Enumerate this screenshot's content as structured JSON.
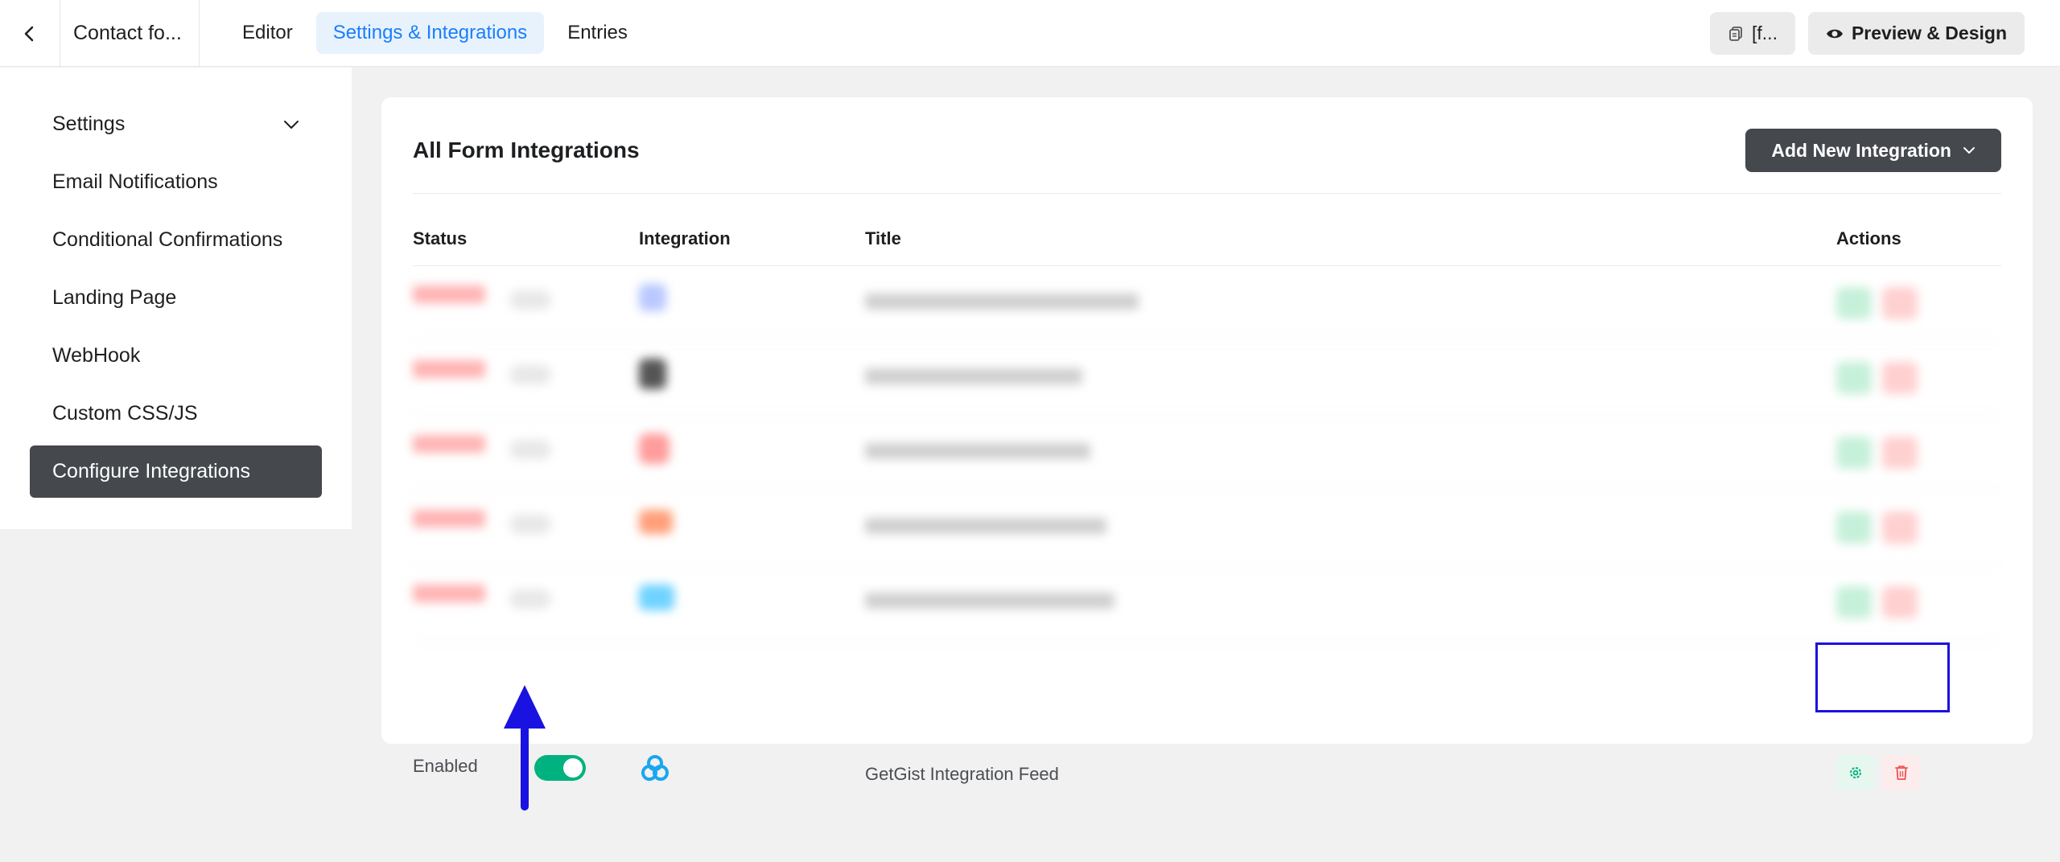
{
  "topbar": {
    "form_name": "Contact fo...",
    "tabs": [
      {
        "label": "Editor",
        "active": false
      },
      {
        "label": "Settings & Integrations",
        "active": true
      },
      {
        "label": "Entries",
        "active": false
      }
    ],
    "shortcode_label": "[f...",
    "preview_label": "Preview & Design"
  },
  "sidebar": {
    "items": [
      {
        "label": "Settings",
        "has_chevron": true
      },
      {
        "label": "Email Notifications"
      },
      {
        "label": "Conditional Confirmations"
      },
      {
        "label": "Landing Page"
      },
      {
        "label": "WebHook"
      },
      {
        "label": "Custom CSS/JS"
      },
      {
        "label": "Configure Integrations",
        "active": true
      }
    ]
  },
  "main": {
    "title": "All Form Integrations",
    "add_button_label": "Add New Integration",
    "columns": {
      "status": "Status",
      "integration": "Integration",
      "title": "Title",
      "actions": "Actions"
    },
    "visible_row": {
      "status": "Enabled",
      "enabled": true,
      "integration_icon": "getgist-logo-icon",
      "title": "GetGist Integration Feed"
    }
  },
  "colors": {
    "accent": "#1a7efb",
    "toggle_on": "#00b27f",
    "dark_button": "#45484d",
    "annotation": "#1a12e0"
  }
}
